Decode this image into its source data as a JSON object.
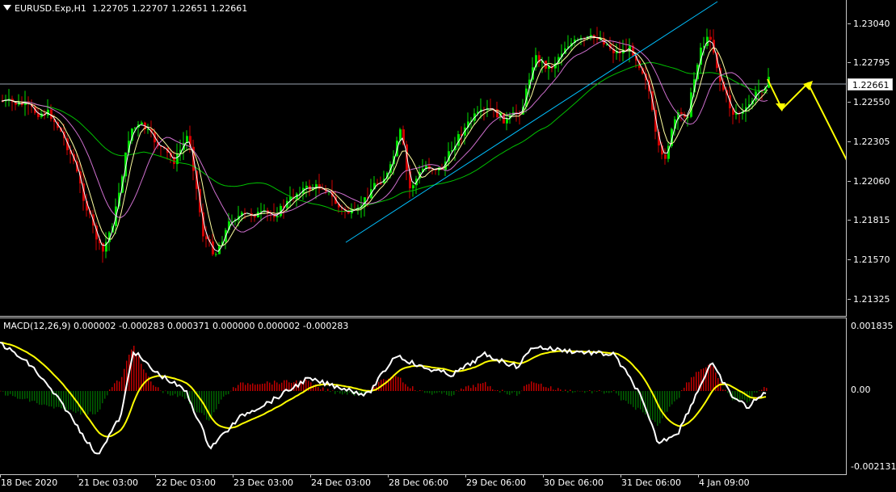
{
  "header": {
    "symbol_timeframe": "EURUSD.Exp,H1",
    "ohlc": "1.22705 1.22707 1.22651 1.22661"
  },
  "macd": {
    "label": "MACD(12,26,9) 0.000002 -0.000283 0.000371 0.000000 0.000002 -0.000283",
    "y_axis": [
      "0.001835",
      "0.00",
      "-0.002131"
    ]
  },
  "price_axis": [
    "1.23040",
    "1.22795",
    "1.22550",
    "1.22305",
    "1.22060",
    "1.21815",
    "1.21570",
    "1.21325"
  ],
  "current_price": "1.22661",
  "time_axis": [
    "18 Dec 2020",
    "21 Dec 03:00",
    "22 Dec 03:00",
    "23 Dec 03:00",
    "24 Dec 03:00",
    "28 Dec 06:00",
    "29 Dec 06:00",
    "30 Dec 06:00",
    "31 Dec 06:00",
    "4 Jan 09:00"
  ],
  "colors": {
    "bull": "#00e000",
    "bear": "#d00000",
    "hist_pos": "#c00000",
    "hist_neg": "#006000",
    "macd_line": "#ffffff",
    "signal_line": "#ffff00",
    "trendline": "#00c0ff",
    "ma_long": "#00c000",
    "ma_mid": "#d070d0",
    "ma_fast1": "#ffffa0",
    "ma_fast2": "#ffffff",
    "arrow": "#ffff00",
    "grid": "#c8c8c8"
  }
}
